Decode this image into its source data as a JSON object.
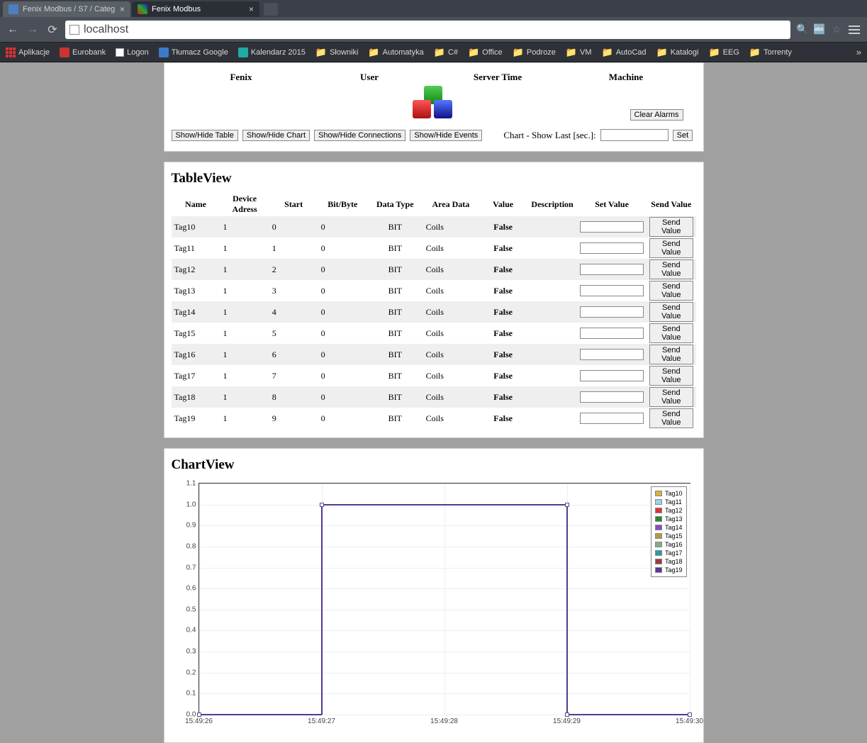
{
  "browser": {
    "tabs": [
      {
        "title": "Fenix Modbus / S7 / Categ",
        "active": false
      },
      {
        "title": "Fenix Modbus",
        "active": true
      }
    ],
    "url": "localhost",
    "bookmarks": [
      {
        "label": "Aplikacje",
        "icon": "apps"
      },
      {
        "label": "Eurobank",
        "icon": "box-red"
      },
      {
        "label": "Logon",
        "icon": "page"
      },
      {
        "label": "Tłumacz Google",
        "icon": "box-blue"
      },
      {
        "label": "Kalendarz 2015",
        "icon": "box-teal"
      },
      {
        "label": "Słowniki",
        "icon": "folder"
      },
      {
        "label": "Automatyka",
        "icon": "folder"
      },
      {
        "label": "C#",
        "icon": "folder"
      },
      {
        "label": "Office",
        "icon": "folder"
      },
      {
        "label": "Podroze",
        "icon": "folder"
      },
      {
        "label": "VM",
        "icon": "folder"
      },
      {
        "label": "AutoCad",
        "icon": "folder"
      },
      {
        "label": "Katalogi",
        "icon": "folder"
      },
      {
        "label": "EEG",
        "icon": "folder"
      },
      {
        "label": "Torrenty",
        "icon": "folder"
      }
    ]
  },
  "header": {
    "cols": [
      "Fenix",
      "User",
      "Server Time",
      "Machine"
    ],
    "clear_alarms": "Clear Alarms",
    "buttons": [
      "Show/Hide Table",
      "Show/Hide Chart",
      "Show/Hide Connections",
      "Show/Hide Events"
    ],
    "chart_last_label": "Chart - Show Last [sec.]:",
    "chart_last_value": "",
    "set_label": "Set"
  },
  "tableview": {
    "title": "TableView",
    "columns": [
      "Name",
      "Device Adress",
      "Start",
      "Bit/Byte",
      "Data Type",
      "Area Data",
      "Value",
      "Description",
      "Set Value",
      "Send Value"
    ],
    "send_value_btn": "Send Value",
    "rows": [
      {
        "name": "Tag10",
        "dev": "1",
        "start": "0",
        "bit": "0",
        "dt": "BIT",
        "area": "Coils",
        "val": "False",
        "desc": "",
        "set": ""
      },
      {
        "name": "Tag11",
        "dev": "1",
        "start": "1",
        "bit": "0",
        "dt": "BIT",
        "area": "Coils",
        "val": "False",
        "desc": "",
        "set": ""
      },
      {
        "name": "Tag12",
        "dev": "1",
        "start": "2",
        "bit": "0",
        "dt": "BIT",
        "area": "Coils",
        "val": "False",
        "desc": "",
        "set": ""
      },
      {
        "name": "Tag13",
        "dev": "1",
        "start": "3",
        "bit": "0",
        "dt": "BIT",
        "area": "Coils",
        "val": "False",
        "desc": "",
        "set": ""
      },
      {
        "name": "Tag14",
        "dev": "1",
        "start": "4",
        "bit": "0",
        "dt": "BIT",
        "area": "Coils",
        "val": "False",
        "desc": "",
        "set": ""
      },
      {
        "name": "Tag15",
        "dev": "1",
        "start": "5",
        "bit": "0",
        "dt": "BIT",
        "area": "Coils",
        "val": "False",
        "desc": "",
        "set": ""
      },
      {
        "name": "Tag16",
        "dev": "1",
        "start": "6",
        "bit": "0",
        "dt": "BIT",
        "area": "Coils",
        "val": "False",
        "desc": "",
        "set": ""
      },
      {
        "name": "Tag17",
        "dev": "1",
        "start": "7",
        "bit": "0",
        "dt": "BIT",
        "area": "Coils",
        "val": "False",
        "desc": "",
        "set": ""
      },
      {
        "name": "Tag18",
        "dev": "1",
        "start": "8",
        "bit": "0",
        "dt": "BIT",
        "area": "Coils",
        "val": "False",
        "desc": "",
        "set": ""
      },
      {
        "name": "Tag19",
        "dev": "1",
        "start": "9",
        "bit": "0",
        "dt": "BIT",
        "area": "Coils",
        "val": "False",
        "desc": "",
        "set": ""
      }
    ]
  },
  "chartview": {
    "title": "ChartView"
  },
  "chart_data": {
    "type": "line",
    "ylim": [
      0.0,
      1.1
    ],
    "yticks": [
      0.0,
      0.1,
      0.2,
      0.3,
      0.4,
      0.5,
      0.6,
      0.7,
      0.8,
      0.9,
      1.0,
      1.1
    ],
    "xticks": [
      "15:49:26",
      "15:49:27",
      "15:49:28",
      "15:49:29",
      "15:49:30"
    ],
    "legend": [
      {
        "name": "Tag10",
        "color": "#d4b43a"
      },
      {
        "name": "Tag11",
        "color": "#9fd1e8"
      },
      {
        "name": "Tag12",
        "color": "#d33"
      },
      {
        "name": "Tag13",
        "color": "#2a8a2a"
      },
      {
        "name": "Tag14",
        "color": "#8a4bbf"
      },
      {
        "name": "Tag15",
        "color": "#b89a3a"
      },
      {
        "name": "Tag16",
        "color": "#7fae95"
      },
      {
        "name": "Tag17",
        "color": "#289aa8"
      },
      {
        "name": "Tag18",
        "color": "#a03a3a"
      },
      {
        "name": "Tag19",
        "color": "#553a8f"
      }
    ],
    "series": [
      {
        "name": "Tag19",
        "color": "#553a8f",
        "x": [
          "15:49:26",
          "15:49:27",
          "15:49:27",
          "15:49:29",
          "15:49:29",
          "15:49:30"
        ],
        "y": [
          0,
          0,
          1,
          1,
          0,
          0
        ]
      }
    ]
  }
}
